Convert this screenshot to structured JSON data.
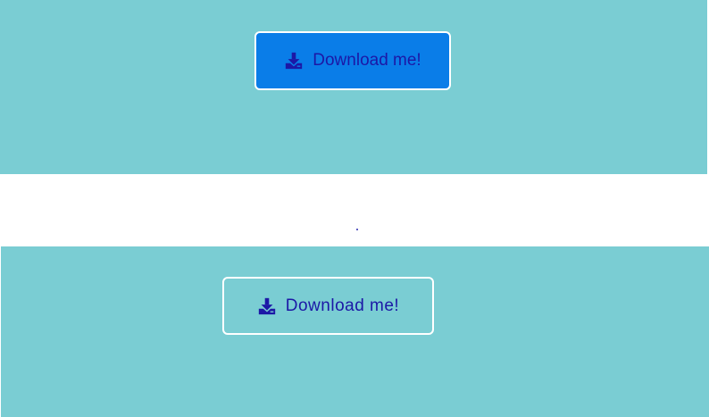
{
  "buttons": {
    "filled": {
      "label": "Download me!",
      "icon": "download-icon"
    },
    "outline": {
      "label": "Download me!",
      "icon": "download-icon"
    }
  },
  "colors": {
    "band_background": "#7acdd3",
    "filled_button_background": "#0a7de8",
    "button_border": "#ffffff",
    "button_text": "#1c18a6"
  }
}
